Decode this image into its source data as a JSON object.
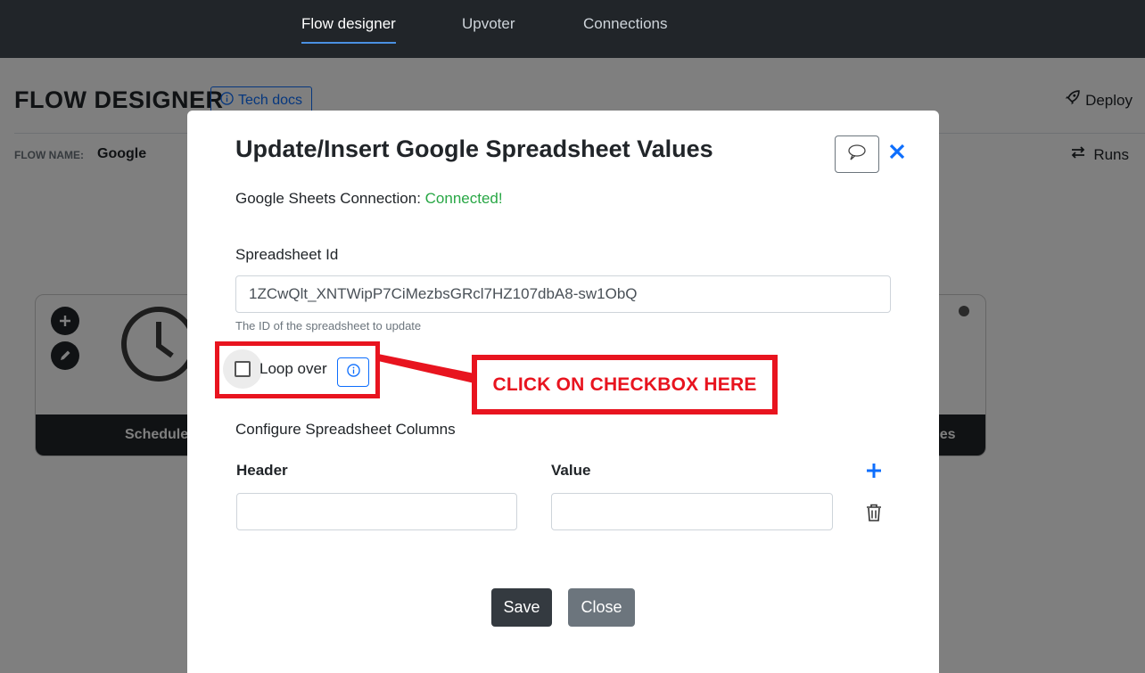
{
  "navbar": {
    "tabs": [
      {
        "label": "Flow designer",
        "active": true
      },
      {
        "label": "Upvoter",
        "active": false
      },
      {
        "label": "Connections",
        "active": false
      }
    ]
  },
  "page": {
    "title": "FLOW DESIGNER",
    "tech_docs_label": "Tech docs",
    "deploy_label": "Deploy",
    "flow_name_label": "FLOW NAME:",
    "flow_name_value": "Google",
    "runs_label": "Runs",
    "node_left_label": "Schedule",
    "node_right_label": "ues"
  },
  "modal": {
    "title": "Update/Insert Google Spreadsheet Values",
    "connection_label": "Google Sheets Connection:",
    "connection_status": "Connected!",
    "spreadsheet_id_label": "Spreadsheet Id",
    "spreadsheet_id_value": "1ZCwQlt_XNTWipP7CiMezbsGRcl7HZ107dbA8-sw1ObQ",
    "spreadsheet_id_help": "The ID of the spreadsheet to update",
    "loop_over_label": "Loop over",
    "loop_over_checked": false,
    "configure_columns_label": "Configure Spreadsheet Columns",
    "header_col_label": "Header",
    "value_col_label": "Value",
    "header_value": "",
    "value_value": "",
    "save_label": "Save",
    "close_label": "Close"
  },
  "annotation": {
    "callout_text": "CLICK ON CHECKBOX HERE"
  },
  "colors": {
    "accent": "#0d6efd",
    "connected": "#28a745",
    "annotation": "#e8141f",
    "navbar": "#212529"
  }
}
